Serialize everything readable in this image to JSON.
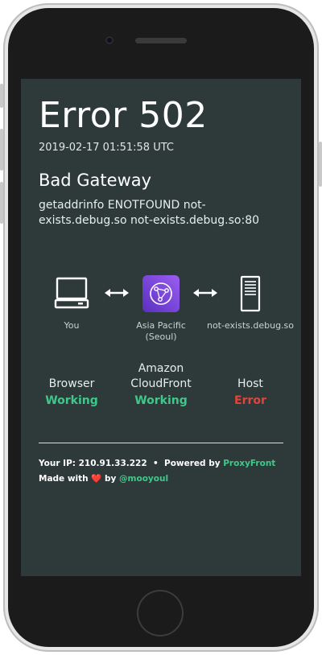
{
  "error": {
    "title": "Error 502",
    "timestamp": "2019-02-17 01:51:58 UTC",
    "subtitle": "Bad Gateway",
    "message": "getaddrinfo ENOTFOUND not-exists.debug.so not-exists.debug.so:80"
  },
  "path": {
    "client_label": "You",
    "edge_label_line1": "Asia Pacific",
    "edge_label_line2": "(Seoul)",
    "host_label": "not-exists.debug.so"
  },
  "status": {
    "browser": {
      "name": "Browser",
      "value": "Working"
    },
    "cloudfront": {
      "name_line1": "Amazon",
      "name_line2": "CloudFront",
      "value": "Working"
    },
    "host": {
      "name": "Host",
      "value": "Error"
    }
  },
  "footer": {
    "ip_label": "Your IP:",
    "ip_value": "210.91.33.222",
    "separator": "•",
    "powered_label": "Powered by",
    "powered_link": "ProxyFront",
    "made_with": "Made with",
    "heart": "❤️",
    "by": "by",
    "author_link": "@mooyoul"
  },
  "colors": {
    "screen_bg": "#2e3a3a",
    "working": "#3ec98a",
    "error": "#e0453b",
    "link": "#3ec98a",
    "cloudfront_icon": "#7b45d6"
  },
  "icons": [
    "laptop-icon",
    "double-arrow-icon",
    "cloudfront-icon",
    "server-icon"
  ]
}
